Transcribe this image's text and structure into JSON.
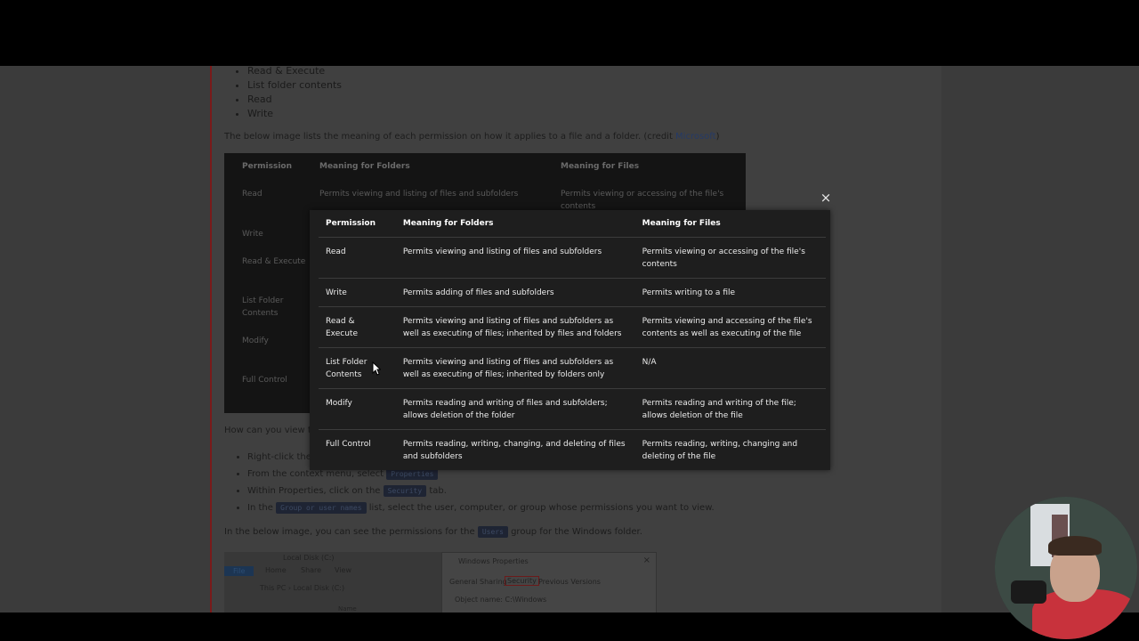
{
  "background_article": {
    "bullets": [
      "Read & Execute",
      "List folder contents",
      "Read",
      "Write"
    ],
    "intro_text": "The below image lists the meaning of each permission on how it applies to a file and a folder. (credit ",
    "intro_link": "Microsoft",
    "intro_close": ")",
    "bg_table": {
      "headers": [
        "Permission",
        "Meaning for Folders",
        "Meaning for Files"
      ],
      "row1": [
        "Read",
        "Permits viewing and listing of files and subfolders",
        "Permits viewing or accessing of the file's"
      ],
      "row1b": "contents",
      "rows_left": [
        "Write",
        "Read & Execute",
        "List Folder",
        "Contents",
        "Modify",
        "Full Control"
      ]
    },
    "how_text": "How can you view th",
    "steps": [
      {
        "pre": "Right-click the",
        "code": "",
        "post": ""
      },
      {
        "pre": "From the context menu, select ",
        "code": "Properties",
        "post": ""
      },
      {
        "pre": "Within Properties, click on the ",
        "code": "Security",
        "post": " tab."
      },
      {
        "pre": "In the ",
        "code": "Group or user names",
        "post": " list, select the user, computer, or group whose permissions you want to view."
      }
    ],
    "below_text_pre": "In the below image, you can see the permissions for the ",
    "below_code": "Users",
    "below_text_post": " group for the Windows folder.",
    "explorer": {
      "title": "Local Disk (C:)",
      "tabs": [
        "File",
        "Home",
        "Share",
        "View"
      ],
      "address": "This PC  ›  Local Disk (C:)",
      "column": "Name"
    },
    "properties_dialog": {
      "title": "Windows Properties",
      "tabs": [
        "General",
        "Sharing",
        "Security",
        "Previous Versions"
      ],
      "object_label": "Object name:",
      "object_value": "C:\\Windows"
    }
  },
  "modal": {
    "headers": [
      "Permission",
      "Meaning for Folders",
      "Meaning for Files"
    ],
    "rows": [
      [
        "Read",
        "Permits viewing and listing of files and subfolders",
        "Permits viewing or accessing of the file's contents"
      ],
      [
        "Write",
        "Permits adding of files and subfolders",
        "Permits writing to a file"
      ],
      [
        "Read & Execute",
        "Permits viewing and listing of files and subfolders as well as executing of files; inherited by files and folders",
        "Permits viewing and accessing of the file's contents as well as executing of the file"
      ],
      [
        "List Folder Contents",
        "Permits viewing and listing of files and subfolders as well as executing of files; inherited by folders only",
        "N/A"
      ],
      [
        "Modify",
        "Permits reading and writing of files and subfolders; allows deletion of the folder",
        "Permits reading and writing of the file; allows deletion of the file"
      ],
      [
        "Full Control",
        "Permits reading, writing, changing, and deleting of files and subfolders",
        "Permits reading, writing, changing and deleting of the file"
      ]
    ],
    "close_glyph": "×"
  },
  "icons": {
    "close": "close-icon",
    "cursor": "mouse-cursor-icon"
  },
  "colors": {
    "modal_bg": "#1e1e1e",
    "link": "#253a66",
    "accent_border": "#7a1a1a"
  }
}
